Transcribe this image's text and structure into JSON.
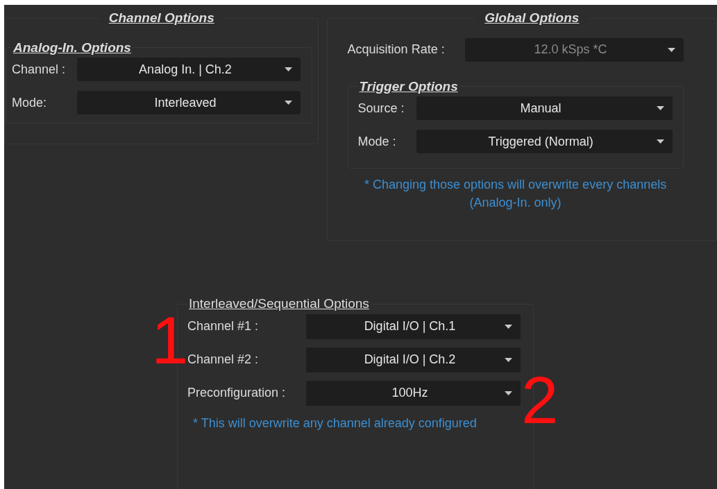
{
  "channel_options": {
    "title": "Channel Options",
    "analog_in": {
      "title": "Analog-In. Options",
      "fields": [
        {
          "label": "Channel :",
          "value": "Analog In. | Ch.2",
          "disabled": false
        },
        {
          "label": "Mode:",
          "value": "Interleaved",
          "disabled": false
        }
      ]
    }
  },
  "global_options": {
    "title": "Global Options",
    "acquisition_rate": {
      "label": "Acquisition Rate :",
      "value": "12.0 kSps *C",
      "disabled": true
    },
    "trigger_options": {
      "title": "Trigger Options",
      "fields": [
        {
          "label": "Source :",
          "value": "Manual",
          "disabled": false
        },
        {
          "label": "Mode :",
          "value": "Triggered (Normal)",
          "disabled": false
        }
      ]
    },
    "note": "* Changing those options will overwrite every channels (Analog-In. only)"
  },
  "sequential_options": {
    "title": "Interleaved/Sequential Options",
    "fields": [
      {
        "label": "Channel #1 :",
        "value": "Digital I/O | Ch.1",
        "disabled": false
      },
      {
        "label": "Channel #2 :",
        "value": "Digital I/O | Ch.2",
        "disabled": false
      },
      {
        "label": "Preconfiguration :",
        "value": "100Hz",
        "disabled": false
      }
    ],
    "note": "* This will overwrite any channel already configured"
  },
  "annotations": [
    "1",
    "2"
  ]
}
